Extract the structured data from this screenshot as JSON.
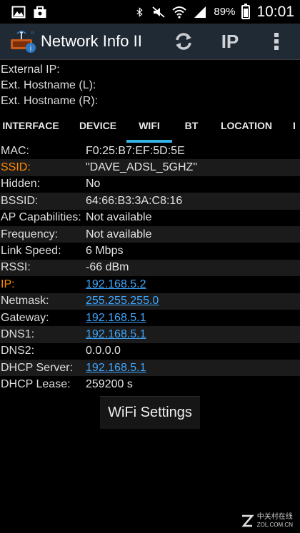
{
  "status_bar": {
    "battery_percent": "89%",
    "time": "10:01",
    "icons": [
      "gallery-icon",
      "bag-icon",
      "bluetooth-icon",
      "mute-icon",
      "wifi-icon",
      "signal-icon",
      "battery-icon"
    ]
  },
  "action_bar": {
    "title": "Network Info II",
    "ip_button": "IP",
    "icons": [
      "app-logo-icon",
      "refresh-icon",
      "overflow-menu-icon"
    ]
  },
  "header": {
    "external_ip": "External IP:",
    "ext_hostname_l": "Ext. Hostname (L):",
    "ext_hostname_r": "Ext. Hostname (R):"
  },
  "tabs": [
    "INTERFACE",
    "DEVICE",
    "WIFI",
    "BT",
    "LOCATION",
    "I"
  ],
  "active_tab": "WIFI",
  "wifi": {
    "rows": [
      {
        "key": "MAC:",
        "value": "F0:25:B7:EF:5D:5E"
      },
      {
        "key": "SSID:",
        "value": "\"DAVE_ADSL_5GHZ\""
      },
      {
        "key": "Hidden:",
        "value": "No"
      },
      {
        "key": "BSSID:",
        "value": "64:66:B3:3A:C8:16"
      },
      {
        "key": "AP Capabilities:",
        "value": "Not available"
      },
      {
        "key": "Frequency:",
        "value": "Not available"
      },
      {
        "key": "Link Speed:",
        "value": "6 Mbps"
      },
      {
        "key": "RSSI:",
        "value": "-66 dBm"
      },
      {
        "key": "IP:",
        "value": "192.168.5.2"
      },
      {
        "key": "Netmask:",
        "value": "255.255.255.0"
      },
      {
        "key": "Gateway:",
        "value": "192.168.5.1"
      },
      {
        "key": "DNS1:",
        "value": "192.168.5.1"
      },
      {
        "key": "DNS2:",
        "value": "0.0.0.0"
      },
      {
        "key": "DHCP Server:",
        "value": "192.168.5.1"
      },
      {
        "key": "DHCP Lease:",
        "value": "259200 s"
      }
    ],
    "settings_button": "WiFi Settings"
  },
  "watermark": {
    "line1": "中关村在线",
    "line2": "ZOL.COM.CN"
  },
  "colors": {
    "action_bar_bg": "#202a34",
    "tab_indicator": "#33b5e5",
    "highlight_key": "#ff8a00",
    "link": "#3fa7ff"
  }
}
